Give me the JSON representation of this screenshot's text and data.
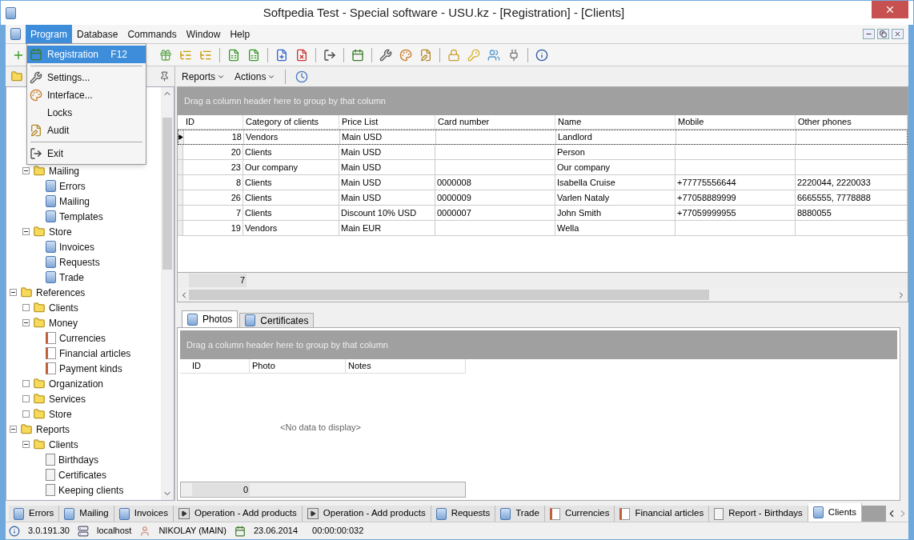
{
  "window": {
    "title": "Softpedia Test - Special software - USU.kz - [Registration] - [Clients]"
  },
  "menu_bar": [
    {
      "label": "Program",
      "selected": true
    },
    {
      "label": "Database",
      "selected": false
    },
    {
      "label": "Commands",
      "selected": false
    },
    {
      "label": "Window",
      "selected": false
    },
    {
      "label": "Help",
      "selected": false
    }
  ],
  "program_menu": [
    {
      "kind": "item",
      "label": "Registration",
      "shortcut": "F12",
      "selected": true
    },
    {
      "kind": "separator"
    },
    {
      "kind": "item",
      "label": "Settings...",
      "selected": false
    },
    {
      "kind": "item",
      "label": "Interface...",
      "selected": false
    },
    {
      "kind": "item",
      "label": "Locks",
      "selected": false
    },
    {
      "kind": "item",
      "label": "Audit",
      "selected": false
    },
    {
      "kind": "separator"
    },
    {
      "kind": "item",
      "label": "Exit",
      "selected": false
    }
  ],
  "tree": {
    "covered_branch": [
      {
        "label": "Mailing",
        "kind": "folder",
        "expanded": true,
        "children": [
          {
            "label": "Errors",
            "kind": "form"
          },
          {
            "label": "Mailing",
            "kind": "form"
          },
          {
            "label": "Templates",
            "kind": "form"
          }
        ]
      },
      {
        "label": "Store",
        "kind": "folder",
        "expanded": true,
        "children": [
          {
            "label": "Invoices",
            "kind": "form"
          },
          {
            "label": "Requests",
            "kind": "form"
          },
          {
            "label": "Trade",
            "kind": "form"
          }
        ]
      }
    ],
    "items": [
      {
        "label": "References",
        "kind": "folder",
        "expanded": true,
        "children": [
          {
            "label": "Clients",
            "kind": "folder",
            "expanded": false
          },
          {
            "label": "Money",
            "kind": "folder",
            "expanded": true,
            "children": [
              {
                "label": "Currencies",
                "kind": "reference"
              },
              {
                "label": "Financial articles",
                "kind": "reference"
              },
              {
                "label": "Payment kinds",
                "kind": "reference"
              }
            ]
          },
          {
            "label": "Organization",
            "kind": "folder",
            "expanded": false
          },
          {
            "label": "Services",
            "kind": "folder",
            "expanded": false
          },
          {
            "label": "Store",
            "kind": "folder",
            "expanded": false
          }
        ]
      },
      {
        "label": "Reports",
        "kind": "folder",
        "expanded": true,
        "children": [
          {
            "label": "Clients",
            "kind": "folder",
            "expanded": true,
            "children": [
              {
                "label": "Birthdays",
                "kind": "report"
              },
              {
                "label": "Certificates",
                "kind": "report"
              },
              {
                "label": "Keeping clients",
                "kind": "report"
              }
            ]
          }
        ]
      }
    ]
  },
  "sub_toolbar": [
    "Reports",
    "Actions"
  ],
  "grid": {
    "group_hint": "Drag a column header here to group by that column",
    "columns": [
      "ID",
      "Category of clients",
      "Price List",
      "Card number",
      "Name",
      "Mobile",
      "Other phones"
    ],
    "rows": [
      {
        "selected": true,
        "cells": [
          "18",
          "Vendors",
          "Main USD",
          "",
          "Landlord",
          "",
          ""
        ]
      },
      {
        "selected": false,
        "cells": [
          "20",
          "Clients",
          "Main USD",
          "",
          "Person",
          "",
          ""
        ]
      },
      {
        "selected": false,
        "cells": [
          "23",
          "Our company",
          "Main USD",
          "",
          "Our company",
          "",
          ""
        ]
      },
      {
        "selected": false,
        "cells": [
          "8",
          "Clients",
          "Main USD",
          "0000008",
          "Isabella Cruise",
          "+77775556644",
          "2220044, 2220033"
        ]
      },
      {
        "selected": false,
        "cells": [
          "26",
          "Clients",
          "Main USD",
          "0000009",
          "Varlen Nataly",
          "+77058889999",
          "6665555, 7778888"
        ]
      },
      {
        "selected": false,
        "cells": [
          "7",
          "Clients",
          "Discount 10% USD",
          "0000007",
          "John Smith",
          "+77059999955",
          "8880055"
        ]
      },
      {
        "selected": false,
        "cells": [
          "19",
          "Vendors",
          "Main EUR",
          "",
          "Wella",
          "",
          ""
        ]
      }
    ],
    "footer_count": "7"
  },
  "detail_tabs": [
    {
      "label": "Photos",
      "selected": true
    },
    {
      "label": "Certificates",
      "selected": false
    }
  ],
  "detail_grid": {
    "group_hint": "Drag a column header here to group by that column",
    "columns": [
      "ID",
      "Photo",
      "Notes"
    ],
    "empty_text": "<No data to display>",
    "footer_count": "0"
  },
  "window_tabs": [
    {
      "label": "Errors",
      "kind": "form",
      "selected": false
    },
    {
      "label": "Mailing",
      "kind": "form",
      "selected": false
    },
    {
      "label": "Invoices",
      "kind": "form",
      "selected": false
    },
    {
      "label": "Operation - Add products",
      "kind": "operation",
      "selected": false
    },
    {
      "label": "Operation - Add products",
      "kind": "operation",
      "selected": false
    },
    {
      "label": "Requests",
      "kind": "form",
      "selected": false
    },
    {
      "label": "Trade",
      "kind": "form",
      "selected": false
    },
    {
      "label": "Currencies",
      "kind": "reference",
      "selected": false
    },
    {
      "label": "Financial articles",
      "kind": "reference",
      "selected": false
    },
    {
      "label": "Report - Birthdays",
      "kind": "report",
      "selected": false
    },
    {
      "label": "Clients",
      "kind": "form",
      "selected": true
    }
  ],
  "status_bar": {
    "version": "3.0.191.30",
    "server": "localhost",
    "user": "NIKOLAY (MAIN)",
    "date": "23.06.2014",
    "timer": "00:00:00:032"
  }
}
